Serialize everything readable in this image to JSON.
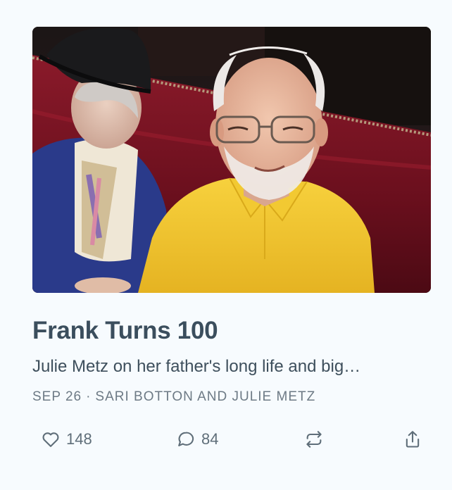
{
  "post": {
    "title": "Frank Turns 100",
    "subtitle": "Julie Metz on her father's long life and big…",
    "date": "SEP 26",
    "separator": "·",
    "authors": "SARI BOTTON AND JULIE METZ",
    "image_alt": "Elderly man in a yellow polo shirt seated in a red booth beside an elderly woman in a black hat"
  },
  "actions": {
    "like_count": "148",
    "comment_count": "84"
  },
  "icons": {
    "like": "heart-icon",
    "comment": "comment-bubble-icon",
    "restack": "restack-icon",
    "share": "share-icon"
  },
  "colors": {
    "background": "#f7fbfe",
    "title": "#3b4e5d",
    "meta": "#6d7a85",
    "icon": "#5f6e79"
  }
}
